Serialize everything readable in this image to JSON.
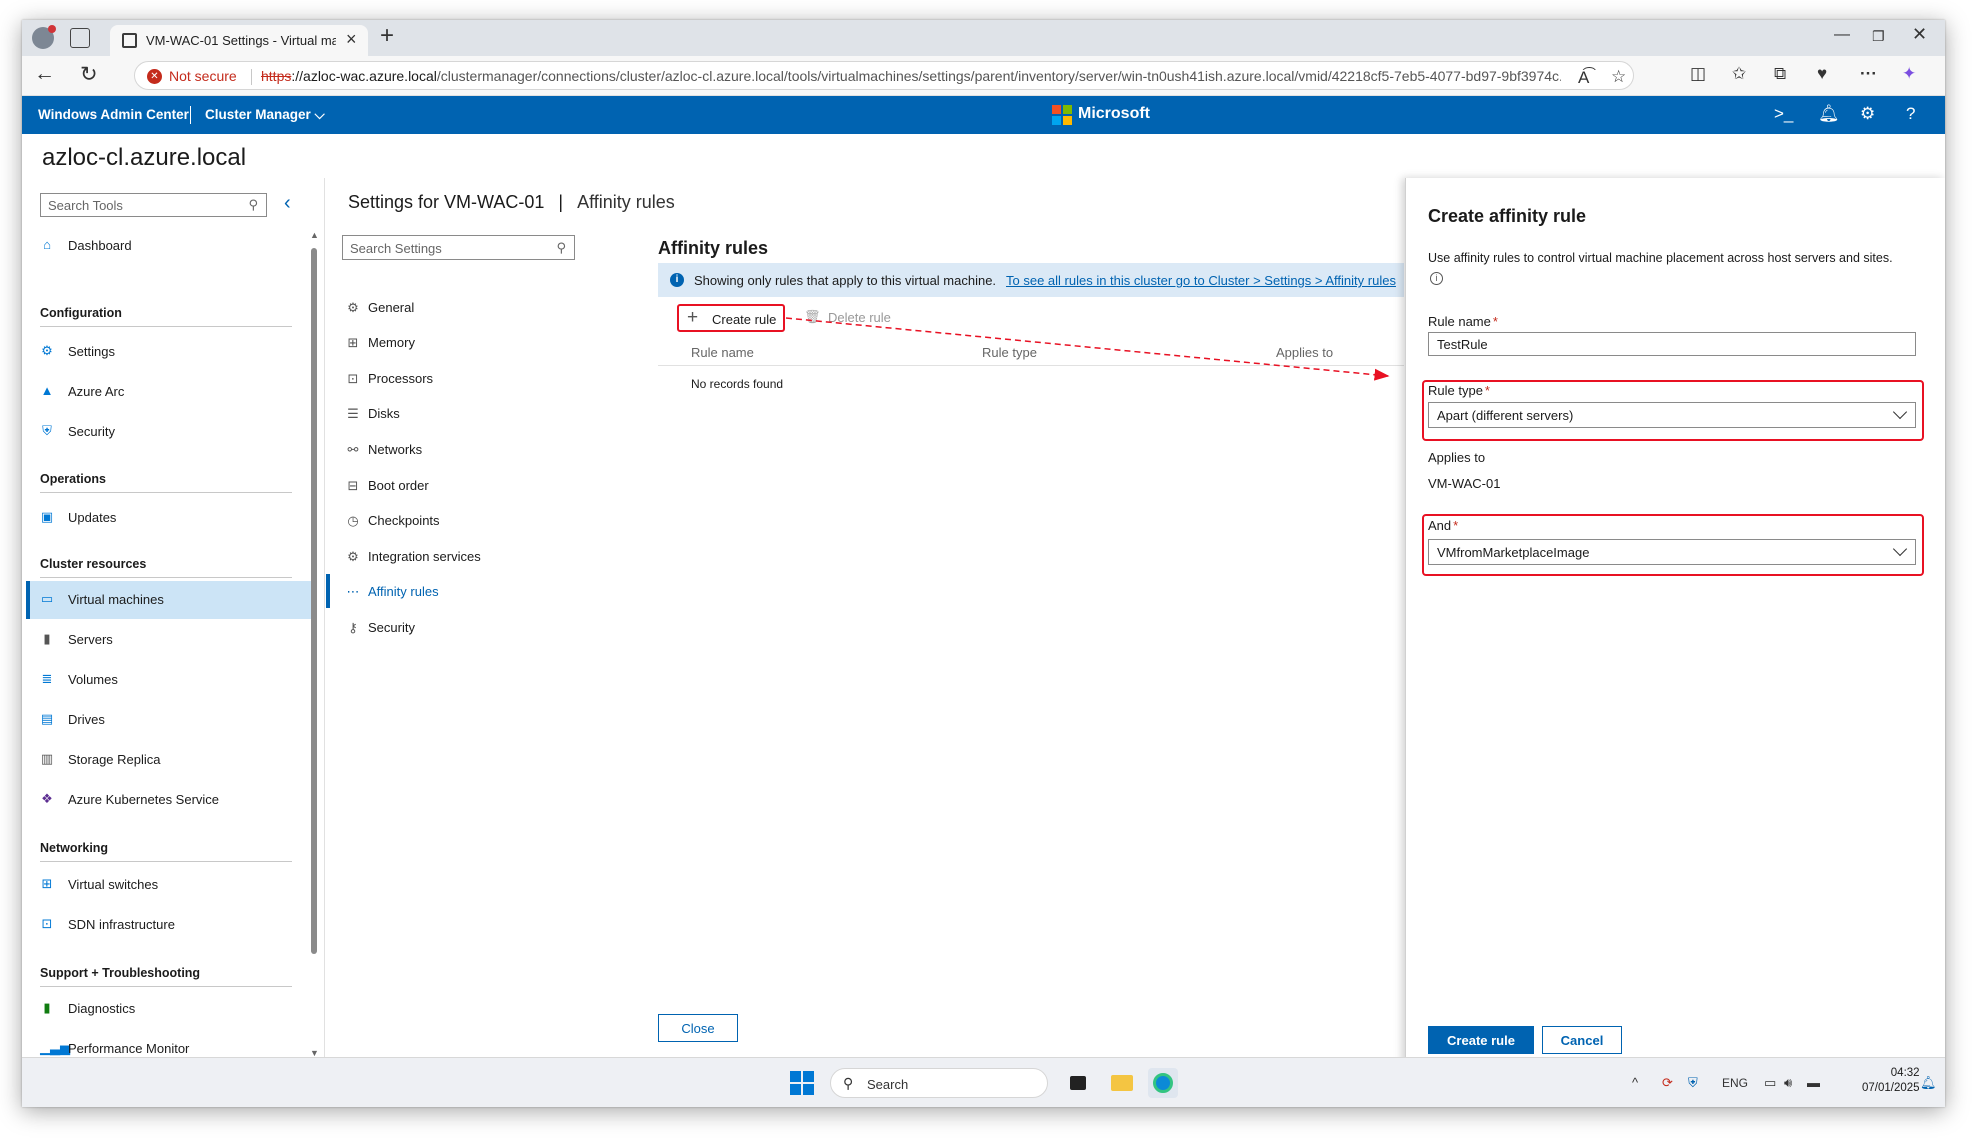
{
  "browser": {
    "tab_title": "VM-WAC-01 Settings - Virtual ma",
    "security_label": "Not secure",
    "url_scheme": "https",
    "url_host": "://azloc-wac.azure.local",
    "url_path": "/clustermanager/connections/cluster/azloc-cl.azure.local/tools/virtualmachines/settings/parent/inventory/server/win-tn0ush41ish.azure.local/vmid/42218cf5-7eb5-4077-bd97-9bf3974c..."
  },
  "header": {
    "app_name": "Windows Admin Center",
    "context": "Cluster Manager",
    "center_brand": "Microsoft"
  },
  "page": {
    "cluster_name": "azloc-cl.azure.local"
  },
  "leftnav": {
    "search_placeholder": "Search Tools",
    "dashboard": "Dashboard",
    "sections": {
      "configuration": "Configuration",
      "operations": "Operations",
      "cluster_resources": "Cluster resources",
      "networking": "Networking",
      "support": "Support + Troubleshooting"
    },
    "items": {
      "settings": "Settings",
      "azure_arc": "Azure Arc",
      "security": "Security",
      "updates": "Updates",
      "virtual_machines": "Virtual machines",
      "servers": "Servers",
      "volumes": "Volumes",
      "drives": "Drives",
      "storage_replica": "Storage Replica",
      "aks": "Azure Kubernetes Service",
      "virtual_switches": "Virtual switches",
      "sdn": "SDN infrastructure",
      "diagnostics": "Diagnostics",
      "perfmon": "Performance Monitor"
    }
  },
  "settings": {
    "title": "Settings for VM-WAC-01",
    "separator": "|",
    "subtitle": "Affinity rules",
    "search_placeholder": "Search Settings",
    "items": [
      "General",
      "Memory",
      "Processors",
      "Disks",
      "Networks",
      "Boot order",
      "Checkpoints",
      "Integration services",
      "Affinity rules",
      "Security"
    ],
    "selected": "Affinity rules"
  },
  "main": {
    "title": "Affinity rules",
    "info_text": "Showing only rules that apply to this virtual machine.",
    "info_link": "To see all rules in this cluster go to Cluster > Settings > Affinity rules",
    "create_label": "Create rule",
    "delete_label": "Delete rule",
    "columns": [
      "Rule name",
      "Rule type",
      "Applies to"
    ],
    "empty_text": "No records found",
    "close_label": "Close"
  },
  "panel": {
    "title": "Create affinity rule",
    "description": "Use affinity rules to control virtual machine placement across host servers and sites.",
    "rule_name_label": "Rule name",
    "rule_name_value": "TestRule",
    "rule_type_label": "Rule type",
    "rule_type_value": "Apart (different servers)",
    "applies_to_label": "Applies to",
    "applies_to_value": "VM-WAC-01",
    "and_label": "And",
    "and_value": "VMfromMarketplaceImage",
    "required_mark": "*",
    "create_button": "Create rule",
    "cancel_button": "Cancel"
  },
  "taskbar": {
    "search_placeholder": "Search",
    "language": "ENG",
    "time": "04:32",
    "date": "07/01/2025",
    "notification_count": "10"
  },
  "colors": {
    "accent": "#0063b1",
    "highlight": "#e81123",
    "selection": "#cce4f6",
    "info_bar": "#dbe9f6"
  },
  "icons": {
    "search": "search-icon",
    "terminal": "terminal-icon",
    "notifications": "bell-icon",
    "settings": "gear-icon",
    "help": "help-icon"
  }
}
